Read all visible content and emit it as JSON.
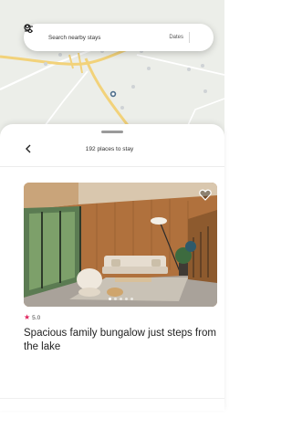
{
  "search": {
    "placeholder": "Search nearby stays",
    "dates_label": "Dates",
    "search_icon": "search-icon",
    "filter_icon": "sliders-icon"
  },
  "map": {
    "road_color": "#f2d27a",
    "land_color": "#eceee9"
  },
  "sheet": {
    "back_icon": "chevron-left-icon",
    "places_count": "192 places to stay"
  },
  "listing": {
    "rating": "5.0",
    "star_color": "#e0245e",
    "title": "Spacious family bungalow just steps from the lake",
    "favorite_icon": "heart-icon",
    "photo_pages": 5,
    "active_photo": 1
  }
}
